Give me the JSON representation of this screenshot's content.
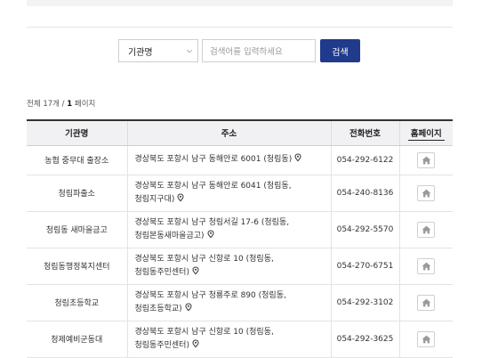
{
  "search": {
    "select_value": "기관명",
    "input_placeholder": "검색어를 입력하세요",
    "button_label": "검색"
  },
  "count": {
    "prefix": "전체 17개 / ",
    "page": "1",
    "suffix": " 페이지"
  },
  "table": {
    "headers": {
      "name": "기관명",
      "address": "주소",
      "phone": "전화번호",
      "homepage": "홈페이지"
    },
    "rows": [
      {
        "name": "농협 중무대 출장소",
        "addr1": "경상북도 포항시 남구 동해안로 6001 (청림동)",
        "addr2": "",
        "phone": "054-292-6122"
      },
      {
        "name": "청림파출소",
        "addr1": "경상북도 포항시 남구 동해안로 6041 (청림동,",
        "addr2": "청림지구대)",
        "phone": "054-240-8136"
      },
      {
        "name": "청림동 새마을금고",
        "addr1": "경상북도 포항시 남구 청림서길 17-6 (청림동,",
        "addr2": "청림본동새마을금고)",
        "phone": "054-292-5570"
      },
      {
        "name": "청림동행정복지센터",
        "addr1": "경상북도 포항시 남구 신항로 10 (청림동,",
        "addr2": "청림동주민센터)",
        "phone": "054-270-6751"
      },
      {
        "name": "청림초등학교",
        "addr1": "경상북도 포항시 남구 청룡주로 890 (청림동,",
        "addr2": "청림초등학교)",
        "phone": "054-292-3102"
      },
      {
        "name": "청제예비군동대",
        "addr1": "경상북도 포항시 남구 신항로 10 (청림동,",
        "addr2": "청림동주민센터)",
        "phone": "054-292-3625"
      }
    ]
  },
  "icons": {
    "map": "map-pin-icon",
    "home": "home-icon"
  },
  "colors": {
    "primary_button": "#203a8c",
    "header_bg": "#f1f1f4"
  }
}
